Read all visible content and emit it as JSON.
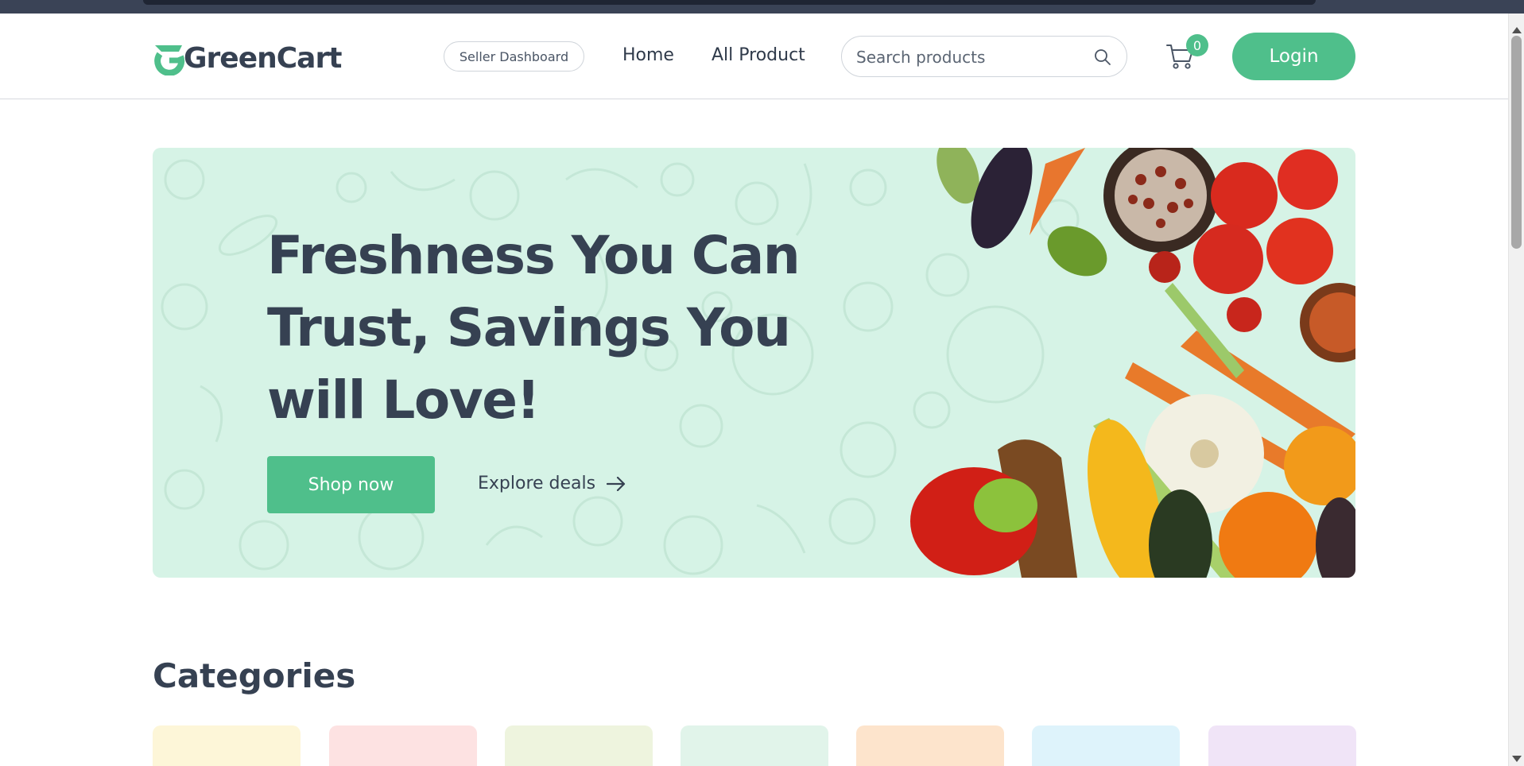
{
  "brand": {
    "name": "GreenCart",
    "accent": "#4fbf8b",
    "text_color": "#364152"
  },
  "navbar": {
    "seller_dashboard": "Seller Dashboard",
    "links": {
      "home": "Home",
      "all_product": "All Product"
    },
    "search": {
      "placeholder": "Search products",
      "icon": "search-icon"
    },
    "cart": {
      "icon": "cart-icon",
      "count": "0"
    },
    "login": "Login"
  },
  "hero": {
    "title": "Freshness You Can Trust, Savings You will Love!",
    "shop_now": "Shop now",
    "explore_deals": "Explore deals",
    "background": "#d6f3e6"
  },
  "categories": {
    "title": "Categories",
    "card_colors": [
      "#fdf6d8",
      "#fde2e2",
      "#eef4de",
      "#e1f4ea",
      "#fde4cc",
      "#def3fb",
      "#f0e4f7"
    ]
  }
}
